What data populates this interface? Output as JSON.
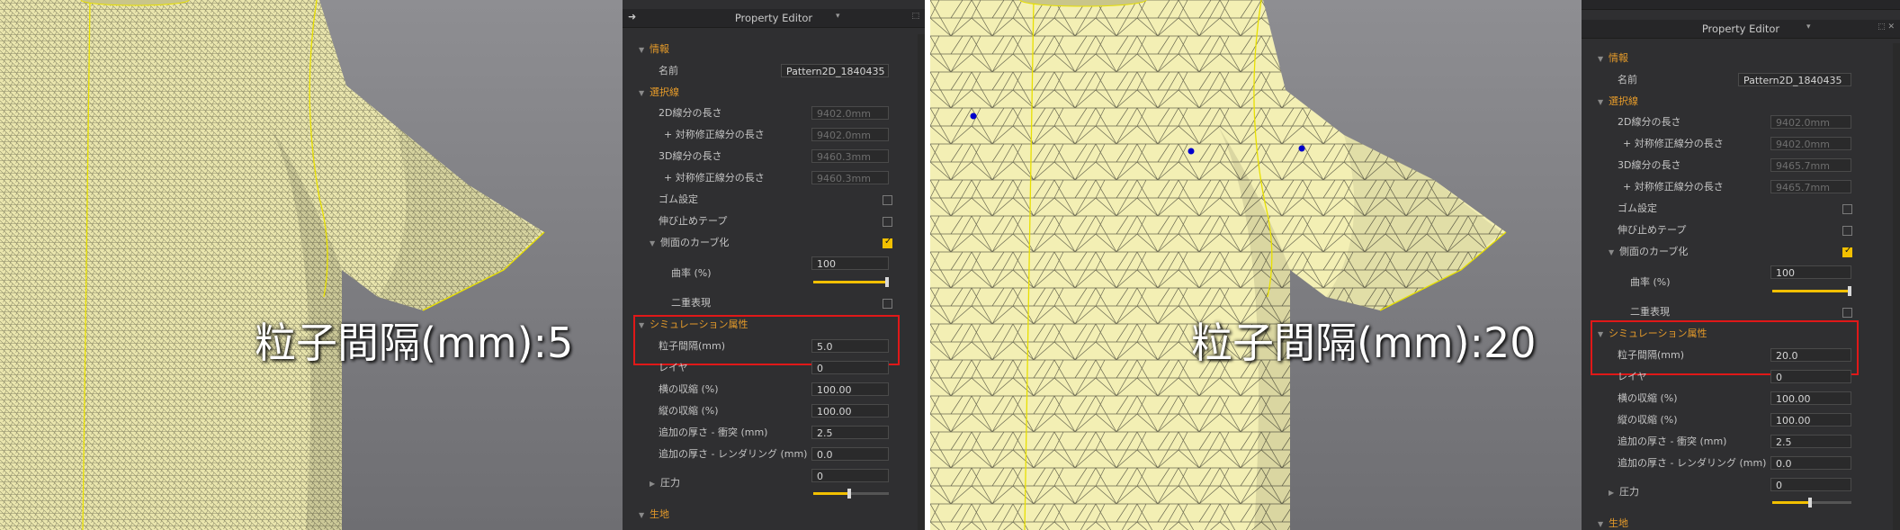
{
  "left": {
    "overlay_label": "粒子間隔(mm):5",
    "panel": {
      "title": "Property Editor",
      "info_section": "情報",
      "name_label": "名前",
      "name_value": "Pattern2D_1840435",
      "selected_section": "選択線",
      "len2d_label": "2D線分の長さ",
      "len2d_value": "9402.0mm",
      "sym2d_label": "+ 対称修正線分の長さ",
      "sym2d_value": "9402.0mm",
      "len3d_label": "3D線分の長さ",
      "len3d_value": "9460.3mm",
      "sym3d_label": "+ 対称修正線分の長さ",
      "sym3d_value": "9460.3mm",
      "elastic_label": "ゴム設定",
      "tape_label": "伸び止めテープ",
      "curve_label": "側面のカーブ化",
      "curvature_label": "曲率 (%)",
      "curvature_value": "100",
      "double_label": "二重表現",
      "sim_section": "シミュレーション属性",
      "particle_label": "粒子間隔(mm)",
      "particle_value": "5.0",
      "layer_label": "レイヤ",
      "layer_value": "0",
      "shrink_h_label": "横の収縮 (%)",
      "shrink_h_value": "100.00",
      "shrink_v_label": "縦の収縮 (%)",
      "shrink_v_value": "100.00",
      "thick_col_label": "追加の厚さ - 衝突 (mm)",
      "thick_col_value": "2.5",
      "thick_ren_label": "追加の厚さ - レンダリング (mm)",
      "thick_ren_value": "0.0",
      "pressure_label": "圧力",
      "pressure_value": "0",
      "fabric_section": "生地"
    }
  },
  "right": {
    "overlay_label": "粒子間隔(mm):20",
    "panel": {
      "title": "Property Editor",
      "info_section": "情報",
      "name_label": "名前",
      "name_value": "Pattern2D_1840435",
      "selected_section": "選択線",
      "len2d_label": "2D線分の長さ",
      "len2d_value": "9402.0mm",
      "sym2d_label": "+ 対称修正線分の長さ",
      "sym2d_value": "9402.0mm",
      "len3d_label": "3D線分の長さ",
      "len3d_value": "9465.7mm",
      "sym3d_label": "+ 対称修正線分の長さ",
      "sym3d_value": "9465.7mm",
      "elastic_label": "ゴム設定",
      "tape_label": "伸び止めテープ",
      "curve_label": "側面のカーブ化",
      "curvature_label": "曲率 (%)",
      "curvature_value": "100",
      "double_label": "二重表現",
      "sim_section": "シミュレーション属性",
      "particle_label": "粒子間隔(mm)",
      "particle_value": "20.0",
      "layer_label": "レイヤ",
      "layer_value": "0",
      "shrink_h_label": "横の収縮 (%)",
      "shrink_h_value": "100.00",
      "shrink_v_label": "縦の収縮 (%)",
      "shrink_v_value": "100.00",
      "thick_col_label": "追加の厚さ - 衝突 (mm)",
      "thick_col_value": "2.5",
      "thick_ren_label": "追加の厚さ - レンダリング (mm)",
      "thick_ren_value": "0.0",
      "pressure_label": "圧力",
      "pressure_value": "0",
      "fabric_section": "生地"
    }
  },
  "states": {
    "elastic_checked": false,
    "tape_checked": false,
    "curve_checked": true,
    "double_checked": false,
    "curvature_slider_fraction": 1.0,
    "pressure_slider_fraction": 0.5
  },
  "icons": [
    "pin-icon",
    "dropdown-icon",
    "collapse-arrow-icon",
    "expand-arrow-icon",
    "checkbox-icon"
  ],
  "colors": {
    "accent": "#f2c000",
    "section_text": "#e49a2a",
    "highlight_box": "#e01818",
    "panel_bg": "#2f2f31",
    "fabric": "#f2eeb2",
    "viewport_bg": "#8a8a8e",
    "seam": "#e8e000",
    "pin_point": "#0000cc"
  }
}
